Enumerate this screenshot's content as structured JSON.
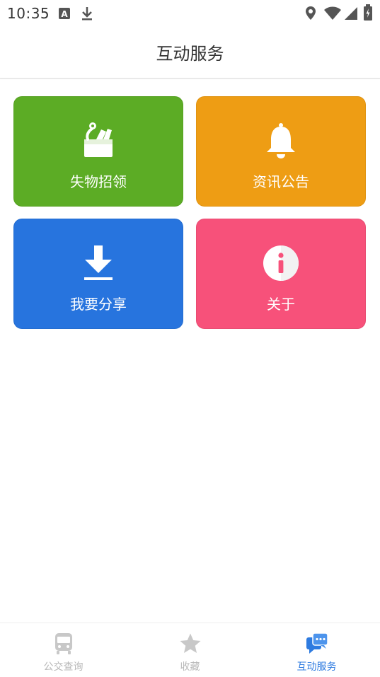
{
  "status_bar": {
    "time": "10:35",
    "icons": [
      "text-a-icon",
      "download-icon",
      "location-icon",
      "wifi-icon",
      "signal-icon",
      "battery-icon"
    ]
  },
  "header": {
    "title": "互动服务"
  },
  "tiles": [
    {
      "label": "失物招领",
      "icon": "lost-found-icon",
      "color": "#5cac25"
    },
    {
      "label": "资讯公告",
      "icon": "bell-icon",
      "color": "#ee9d14"
    },
    {
      "label": "我要分享",
      "icon": "download-share-icon",
      "color": "#2774de"
    },
    {
      "label": "关于",
      "icon": "info-icon",
      "color": "#f7517a"
    }
  ],
  "bottom_nav": {
    "items": [
      {
        "label": "公交查询",
        "icon": "bus-icon",
        "active": false
      },
      {
        "label": "收藏",
        "icon": "star-icon",
        "active": false
      },
      {
        "label": "互动服务",
        "icon": "chat-icon",
        "active": true
      }
    ],
    "active_color": "#2e7be0",
    "inactive_color": "#b8b8b8"
  }
}
